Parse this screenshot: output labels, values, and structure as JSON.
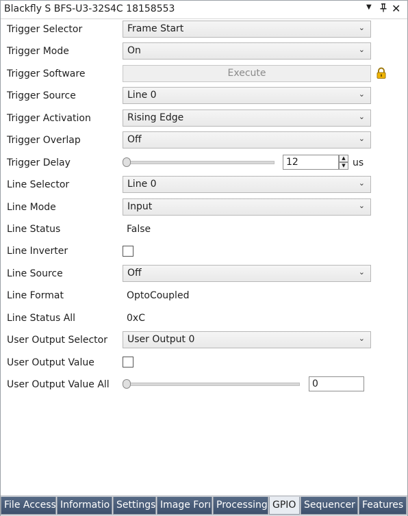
{
  "window": {
    "title": "Blackfly S BFS-U3-32S4C 18158553",
    "menu_icon": "dropdown-arrow-icon",
    "pin_icon": "pin-icon",
    "close_icon": "close-icon",
    "menu_glyph": "▼",
    "pin_glyph": "ᵽ",
    "close_glyph": "✕"
  },
  "chevron": "⌄",
  "rows": {
    "trigger_selector": {
      "label": "Trigger Selector",
      "value": "Frame Start"
    },
    "trigger_mode": {
      "label": "Trigger Mode",
      "value": "On"
    },
    "trigger_software": {
      "label": "Trigger Software",
      "button": "Execute",
      "lock_icon": "lock-icon"
    },
    "trigger_source": {
      "label": "Trigger Source",
      "value": "Line 0"
    },
    "trigger_activation": {
      "label": "Trigger Activation",
      "value": "Rising Edge"
    },
    "trigger_overlap": {
      "label": "Trigger Overlap",
      "value": "Off"
    },
    "trigger_delay": {
      "label": "Trigger Delay",
      "value": "12",
      "unit": "us"
    },
    "line_selector": {
      "label": "Line Selector",
      "value": "Line 0"
    },
    "line_mode": {
      "label": "Line Mode",
      "value": "Input"
    },
    "line_status": {
      "label": "Line Status",
      "value": "False"
    },
    "line_inverter": {
      "label": "Line Inverter",
      "checked": false
    },
    "line_source": {
      "label": "Line Source",
      "value": "Off"
    },
    "line_format": {
      "label": "Line Format",
      "value": "OptoCoupled"
    },
    "line_status_all": {
      "label": "Line Status All",
      "value": "0xC"
    },
    "user_output_selector": {
      "label": "User Output Selector",
      "value": "User Output 0"
    },
    "user_output_value": {
      "label": "User Output Value",
      "checked": false
    },
    "user_output_value_all": {
      "label": "User Output Value All",
      "value": "0"
    }
  },
  "tabs": [
    {
      "label": "File Access",
      "active": false
    },
    {
      "label": "Informatio",
      "active": false
    },
    {
      "label": "Settings",
      "active": false
    },
    {
      "label": "Image Forı",
      "active": false
    },
    {
      "label": "Processing",
      "active": false
    },
    {
      "label": "GPIO",
      "active": true
    },
    {
      "label": "Sequencer",
      "active": false
    },
    {
      "label": "Features",
      "active": false
    }
  ]
}
